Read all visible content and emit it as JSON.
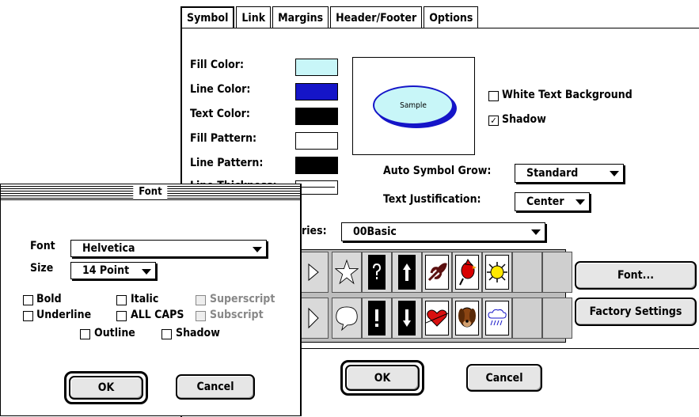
{
  "tabs": [
    "Symbol",
    "Link",
    "Margins",
    "Header/Footer",
    "Options"
  ],
  "symbol": {
    "fill_color_label": "Fill Color:",
    "line_color_label": "Line Color:",
    "text_color_label": "Text Color:",
    "fill_pattern_label": "Fill Pattern:",
    "line_pattern_label": "Line Pattern:",
    "line_thickness_label": "Line Thickness:",
    "colors": {
      "fill": "#c8f6f8",
      "line": "#1515c8",
      "text": "#000000",
      "fill_pattern": "#ffffff",
      "line_pattern": "#000000"
    },
    "preview_text": "Sample",
    "white_text_bg_label": "White Text Background",
    "white_text_bg_checked": false,
    "shadow_label": "Shadow",
    "shadow_checked": true,
    "auto_grow_label": "Auto Symbol Grow:",
    "auto_grow_value": "Standard",
    "justification_label": "Text Justification:",
    "justification_value": "Center",
    "libraries_label": "ries:",
    "library_value": "00Basic",
    "font_button": "Font...",
    "factory_button": "Factory Settings",
    "ok_button": "OK",
    "cancel_button": "Cancel",
    "palette_icons": [
      "star-icon",
      "question-mark-icon",
      "up-arrow-icon",
      "leaf-icon",
      "cardinal-bird-icon",
      "sun-icon",
      "speech-bubble-icon",
      "exclamation-icon",
      "down-arrow-icon",
      "heart-icon",
      "dog-icon",
      "rain-cloud-icon"
    ]
  },
  "font_dialog": {
    "title": "Font",
    "font_label": "Font",
    "font_value": "Helvetica",
    "size_label": "Size",
    "size_value": "14 Point",
    "styles": {
      "bold": "Bold",
      "italic": "Italic",
      "superscript": "Superscript",
      "underline": "Underline",
      "all_caps": "ALL CAPS",
      "subscript": "Subscript",
      "outline": "Outline",
      "shadow": "Shadow"
    },
    "ok_button": "OK",
    "cancel_button": "Cancel"
  }
}
